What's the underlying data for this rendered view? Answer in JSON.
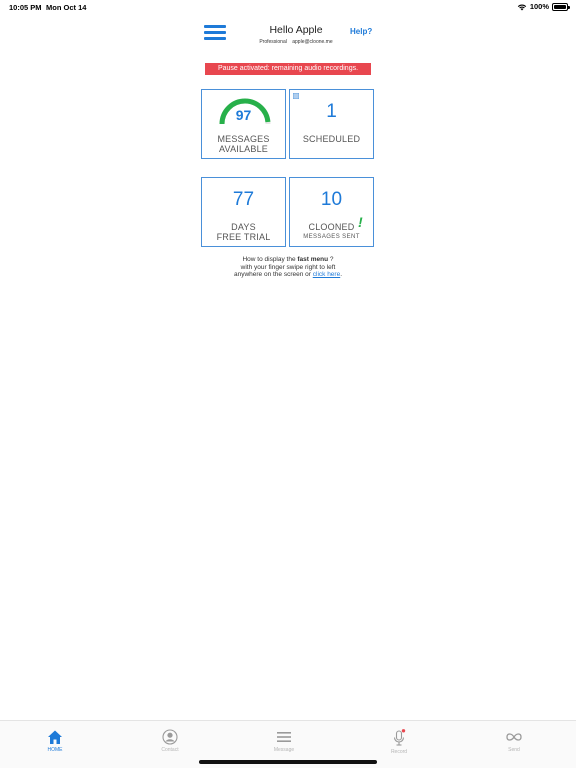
{
  "status_bar": {
    "time": "10:05 PM",
    "date": "Mon Oct 14",
    "battery": "100%"
  },
  "header": {
    "greeting": "Hello Apple",
    "plan": "Professional",
    "email": "apple@cloone.me",
    "help": "Help?"
  },
  "banner": {
    "text": "Pause activated: remaining audio recordings."
  },
  "tiles": {
    "messages": {
      "value": "97",
      "label_line1": "MESSAGES",
      "label_line2": "AVAILABLE",
      "gauge_fraction": 0.97
    },
    "scheduled": {
      "value": "1",
      "label": "SCHEDULED"
    },
    "trial": {
      "value": "77",
      "label_line1": "DAYS",
      "label_line2": "FREE TRIAL"
    },
    "cloned": {
      "value": "10",
      "label": "CLOONED",
      "sublabel": "MESSAGES SENT"
    }
  },
  "help_text": {
    "line1_prefix": "How to display the ",
    "line1_bold": "fast menu",
    "line1_suffix": " ?",
    "line2": "with your finger swipe right to left",
    "line3_prefix": "anywhere on the screen or ",
    "line3_link": "click here",
    "line3_suffix": "."
  },
  "tab_bar": {
    "home": "HOME",
    "contact": "Contact",
    "message": "Message",
    "record": "Record",
    "send": "Send"
  },
  "colors": {
    "accent": "#1e7ad8",
    "banner": "#e8474f",
    "gauge": "#27b04a",
    "tile_border": "#4a90d9"
  }
}
